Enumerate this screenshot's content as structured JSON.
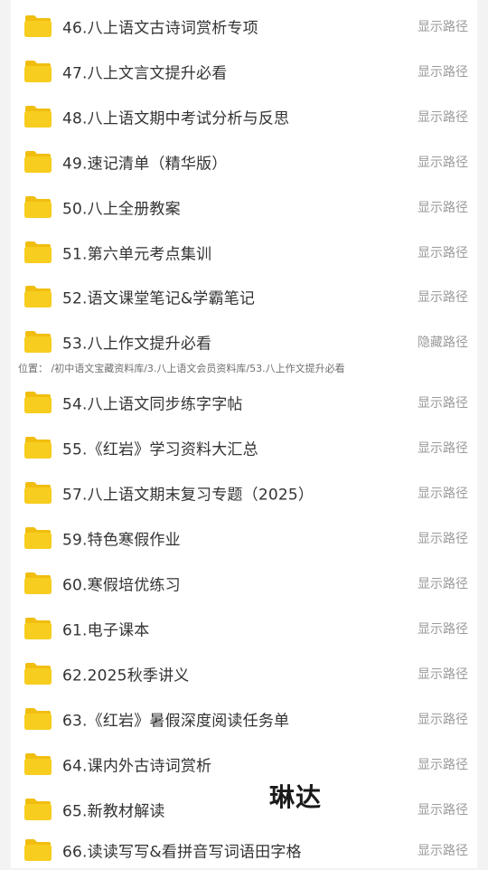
{
  "items_top": [
    {
      "title": "46.八上语文古诗词赏析专项",
      "action": "显示路径"
    },
    {
      "title": "47.八上文言文提升必看",
      "action": "显示路径"
    },
    {
      "title": "48.八上语文期中考试分析与反思",
      "action": "显示路径"
    },
    {
      "title": "49.速记清单（精华版）",
      "action": "显示路径"
    },
    {
      "title": "50.八上全册教案",
      "action": "显示路径"
    },
    {
      "title": "51.第六单元考点集训",
      "action": "显示路径"
    },
    {
      "title": "52.语文课堂笔记&学霸笔记",
      "action": "显示路径"
    },
    {
      "title": "53.八上作文提升必看",
      "action": "隐藏路径"
    }
  ],
  "path_info": "位置： /初中语文宝藏资料库/3.八上语文会员资料库/53.八上作文提升必看",
  "items_bottom": [
    {
      "title": "54.八上语文同步练字字帖",
      "action": "显示路径"
    },
    {
      "title": "55.《红岩》学习资料大汇总",
      "action": "显示路径"
    },
    {
      "title": "57.八上语文期末复习专题（2025）",
      "action": "显示路径"
    },
    {
      "title": "59.特色寒假作业",
      "action": "显示路径"
    },
    {
      "title": "60.寒假培优练习",
      "action": "显示路径"
    },
    {
      "title": "61.电子课本",
      "action": "显示路径"
    },
    {
      "title": "62.2025秋季讲义",
      "action": "显示路径"
    },
    {
      "title": "63.《红岩》暑假深度阅读任务单",
      "action": "显示路径"
    },
    {
      "title": "64.课内外古诗词赏析",
      "action": "显示路径"
    },
    {
      "title": "65.新教材解读",
      "action": "显示路径"
    },
    {
      "title": "66.读读写写&看拼音写词语田字格",
      "action": "显示路径"
    }
  ],
  "watermark": "琳达",
  "colors": {
    "folder": "#F7CD1F",
    "folder_tab": "#F1BE10",
    "title_text": "#333333",
    "action_text": "#9A9A9A"
  },
  "icon": "folder-icon"
}
